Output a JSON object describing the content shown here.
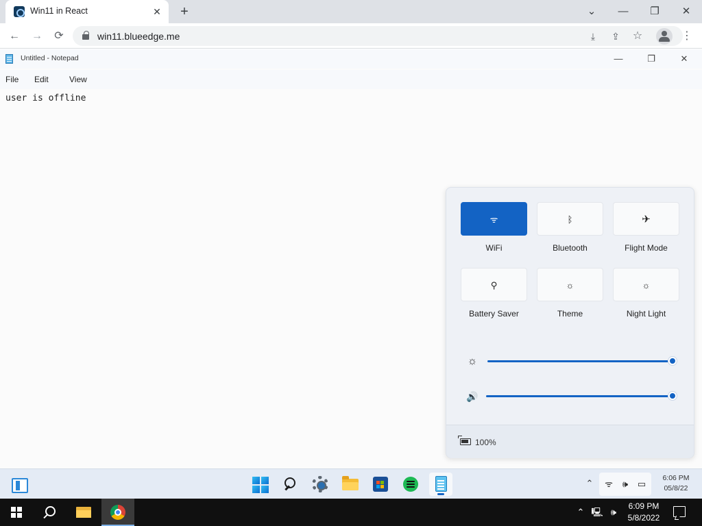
{
  "browser": {
    "tab": {
      "title": "Win11 in React",
      "close_icon": "close-icon"
    },
    "new_tab_glyph": "+",
    "window_controls": {
      "tabs_menu": "⌄",
      "minimize": "—",
      "restore": "❐",
      "close": "✕"
    },
    "toolbar": {
      "back": "←",
      "forward": "→",
      "reload": "⟳",
      "url": "win11.blueedge.me",
      "install": "⤓",
      "share": "⇪",
      "bookmark": "☆",
      "menu": "⋮"
    }
  },
  "notepad": {
    "title": "Untitled - Notepad",
    "window_controls": {
      "minimize": "—",
      "maximize": "❐",
      "close": "✕"
    },
    "menu": [
      "File",
      "Edit",
      "View"
    ],
    "content": "user is offline"
  },
  "quick_settings": {
    "tiles": [
      {
        "label": "WiFi",
        "icon": "wifi-icon",
        "glyph": "ᯤ",
        "active": true
      },
      {
        "label": "Bluetooth",
        "icon": "bluetooth-icon",
        "glyph": "ᛒ",
        "active": false
      },
      {
        "label": "Flight Mode",
        "icon": "airplane-icon",
        "glyph": "✈",
        "active": false
      },
      {
        "label": "Battery Saver",
        "icon": "battery-saver-icon",
        "glyph": "⚲",
        "active": false
      },
      {
        "label": "Theme",
        "icon": "theme-icon",
        "glyph": "☼",
        "active": false
      },
      {
        "label": "Night Light",
        "icon": "night-light-icon",
        "glyph": "☼",
        "active": false
      }
    ],
    "sliders": {
      "brightness": {
        "icon": "brightness-icon",
        "glyph": "☼",
        "value": 1.0
      },
      "volume": {
        "icon": "volume-icon",
        "glyph": "🔊",
        "value": 1.0
      }
    },
    "battery": "100%"
  },
  "win11_taskbar": {
    "apps": [
      "widgets",
      "start",
      "search",
      "settings",
      "file-explorer",
      "store",
      "spotify",
      "notepad"
    ],
    "active_app": "notepad",
    "tray": {
      "chevron": "⌃",
      "wifi": "ᯤ",
      "volume": "🕪",
      "battery": "▭"
    },
    "clock": {
      "time": "6:06 PM",
      "date": "05/8/22"
    }
  },
  "host_taskbar": {
    "apps": [
      "file-explorer",
      "chrome"
    ],
    "active_app": "chrome",
    "tray": {
      "chevron": "⌃",
      "network": "🖳",
      "volume": "🕪"
    },
    "clock": {
      "time": "6:09 PM",
      "date": "5/8/2022"
    }
  },
  "colors": {
    "accent": "#1363c4",
    "host_taskbar": "#101010",
    "win11_taskbar": "#e4ebf5",
    "quick_settings_bg": "#eef1f6"
  }
}
